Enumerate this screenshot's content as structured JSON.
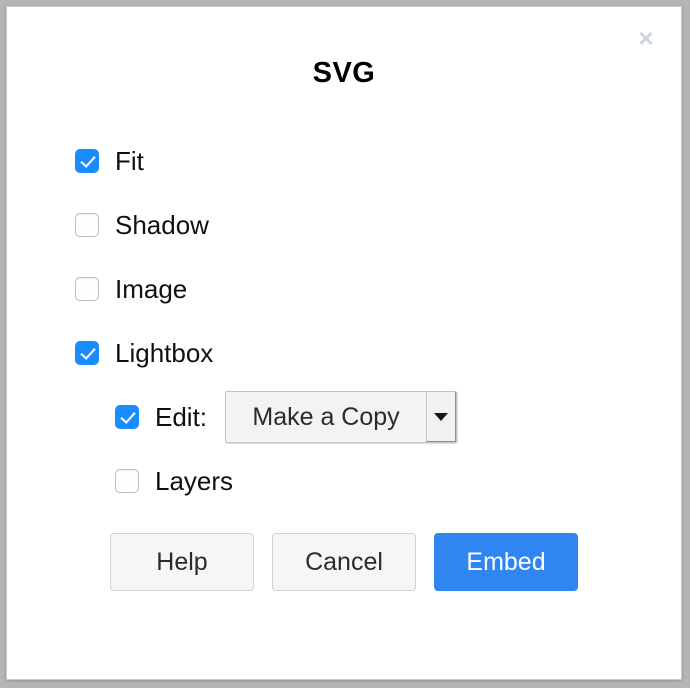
{
  "dialog": {
    "title": "SVG",
    "close_icon": "close-icon",
    "close_glyph": "×",
    "accent_color": "#2f86f1",
    "checkbox_on_color": "#1a8cff",
    "close_icon_color": "#c6d7e8"
  },
  "options": [
    {
      "label": "Fit",
      "checked": true,
      "name": "fit"
    },
    {
      "label": "Shadow",
      "checked": false,
      "name": "shadow"
    },
    {
      "label": "Image",
      "checked": false,
      "name": "image"
    },
    {
      "label": "Lightbox",
      "checked": true,
      "name": "lightbox"
    }
  ],
  "edit": {
    "label": "Edit:",
    "checked": true,
    "select": {
      "value": "Make a Copy",
      "arrow_icon": "chevron-down-icon"
    }
  },
  "layers": {
    "label": "Layers",
    "checked": false
  },
  "buttons": {
    "help": "Help",
    "cancel": "Cancel",
    "embed": "Embed"
  }
}
